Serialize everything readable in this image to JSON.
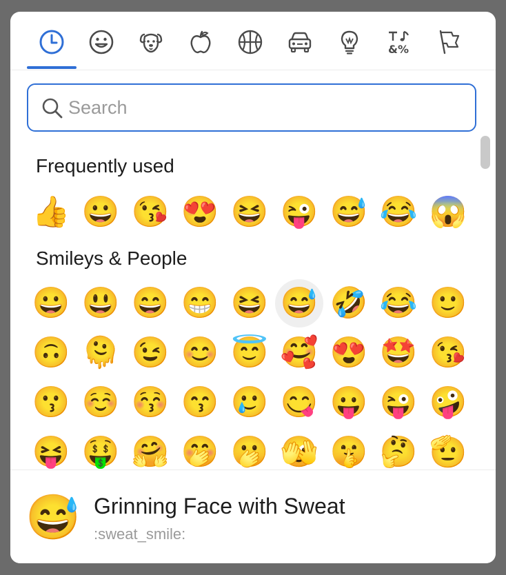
{
  "tabs": [
    {
      "name": "tab-recent",
      "icon": "clock-icon",
      "selected": true
    },
    {
      "name": "tab-smileys",
      "icon": "smiley-icon",
      "selected": false
    },
    {
      "name": "tab-animals",
      "icon": "dog-icon",
      "selected": false
    },
    {
      "name": "tab-food",
      "icon": "apple-icon",
      "selected": false
    },
    {
      "name": "tab-activity",
      "icon": "basketball-icon",
      "selected": false
    },
    {
      "name": "tab-travel",
      "icon": "car-icon",
      "selected": false
    },
    {
      "name": "tab-objects",
      "icon": "lightbulb-icon",
      "selected": false
    },
    {
      "name": "tab-symbols",
      "icon": "symbols-icon",
      "selected": false
    },
    {
      "name": "tab-flags",
      "icon": "flag-icon",
      "selected": false
    }
  ],
  "accent_color": "#2f6fd6",
  "search": {
    "placeholder": "Search",
    "value": ""
  },
  "sections": {
    "frequent": {
      "title": "Frequently used",
      "emojis": [
        "👍",
        "😀",
        "😘",
        "😍",
        "😆",
        "😜",
        "😅",
        "😂",
        "😱"
      ]
    },
    "smileys": {
      "title": "Smileys & People",
      "rows": [
        [
          "😀",
          "😃",
          "😄",
          "😁",
          "😆",
          "😅",
          "🤣",
          "😂",
          "🙂"
        ],
        [
          "🙃",
          "🫠",
          "😉",
          "😊",
          "😇",
          "🥰",
          "😍",
          "🤩",
          "😘"
        ],
        [
          "😗",
          "☺️",
          "😚",
          "😙",
          "🥲",
          "😋",
          "😛",
          "😜",
          "🤪"
        ],
        [
          "😝",
          "🤑",
          "🤗",
          "🤭",
          "🫢",
          "🫣",
          "🤫",
          "🤔",
          "🫡"
        ]
      ],
      "selected_emoji": "😅"
    }
  },
  "footer": {
    "emoji": "😅",
    "name": "Grinning Face with Sweat",
    "shortcode": ":sweat_smile:"
  }
}
